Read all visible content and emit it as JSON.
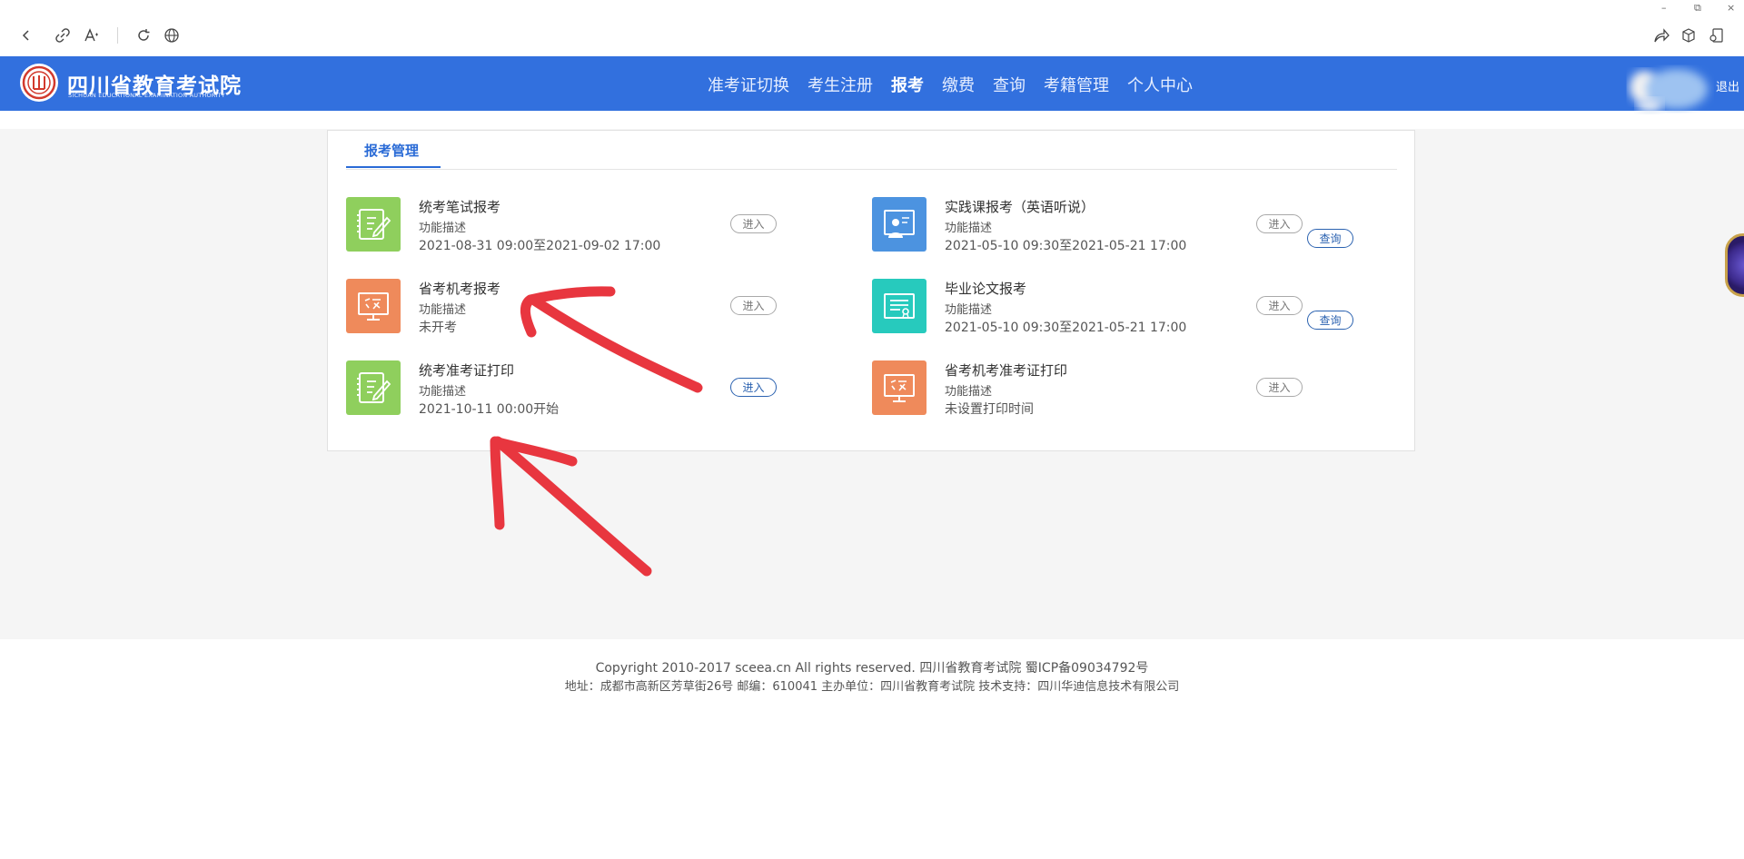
{
  "window_controls": {
    "minimize": "–",
    "restore": "⧉",
    "close": "×"
  },
  "site": {
    "logo_title": "四川省教育考试院",
    "logo_subtitle": "SICHUAN EDUCATIONAL EXAMINATION AUTHORITY",
    "nav": [
      "准考证切换",
      "考生注册",
      "报考",
      "缴费",
      "查询",
      "考籍管理",
      "个人中心"
    ],
    "active_nav": "报考",
    "logout": "退出"
  },
  "panel": {
    "tab": "报考管理",
    "services": [
      {
        "title": "统考笔试报考",
        "desc": "功能描述",
        "time": "2021-08-31 09:00至2021-09-02 17:00",
        "enter": "进入",
        "icon": "edit-notebook-icon",
        "color": "#8fcf5d"
      },
      {
        "title": "省考机考报考",
        "desc": "功能描述",
        "time": "未开考",
        "enter": "进入",
        "icon": "computer-exam-icon",
        "color": "#ef8a5b"
      },
      {
        "title": "统考准考证打印",
        "desc": "功能描述",
        "time": "2021-10-11 00:00开始",
        "enter": "进入",
        "icon": "edit-notebook-icon",
        "color": "#8fcf5d"
      },
      {
        "title": "实践课报考（英语听说）",
        "desc": "功能描述",
        "time": "2021-05-10 09:30至2021-05-21 17:00",
        "enter": "进入",
        "query": "查询",
        "icon": "teacher-board-icon",
        "color": "#4c93e0"
      },
      {
        "title": "毕业论文报考",
        "desc": "功能描述",
        "time": "2021-05-10 09:30至2021-05-21 17:00",
        "enter": "进入",
        "query": "查询",
        "icon": "certificate-icon",
        "color": "#27cabd"
      },
      {
        "title": "省考机考准考证打印",
        "desc": "功能描述",
        "time": "未设置打印时间",
        "enter": "进入",
        "icon": "computer-exam-icon",
        "color": "#ef8a5b"
      }
    ]
  },
  "footer": {
    "line1": "Copyright 2010-2017 sceea.cn All rights reserved. 四川省教育考试院 蜀ICP备09034792号",
    "line2": "地址：成都市高新区芳草街26号 邮编：610041 主办单位：四川省教育考试院 技术支持：四川华迪信息技术有限公司"
  },
  "colors": {
    "header": "#3270de",
    "accent": "#2a6bd6",
    "annotation_arrow": "#e8363f"
  }
}
